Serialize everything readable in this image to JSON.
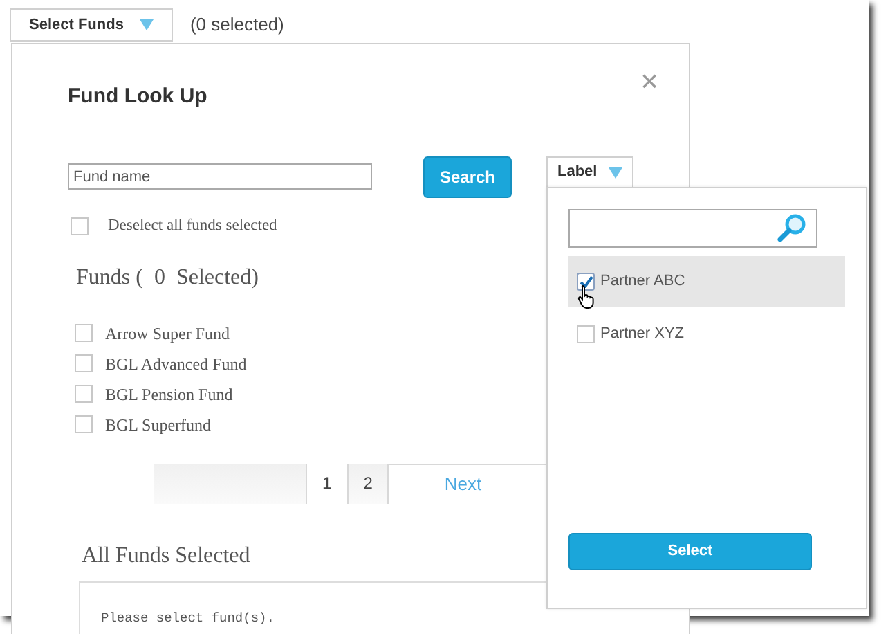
{
  "top_bar": {
    "button": "Select Funds",
    "count": "(0 selected)"
  },
  "dialog": {
    "title": "Fund Look Up",
    "close": "×",
    "search_field": {
      "placeholder": "Fund name"
    },
    "search_button": "Search",
    "label_button": "Label",
    "deselect": {
      "label": "Deselect all funds selected",
      "checked": false
    },
    "funds_heading": "Funds (  0  Selected)",
    "funds": [
      {
        "name": "Arrow Super Fund",
        "checked": false
      },
      {
        "name": "BGL Advanced Fund",
        "checked": false
      },
      {
        "name": "BGL Pension Fund",
        "checked": false
      },
      {
        "name": "BGL Superfund",
        "checked": false
      }
    ],
    "pages": [
      {
        "label": "1",
        "selected": true
      },
      {
        "label": "2",
        "selected": false
      }
    ],
    "next": "Next",
    "selected_heading": "All Funds Selected",
    "selected_message": "Please select fund(s)."
  },
  "label_dropdown": {
    "labels": [
      {
        "name": "Partner ABC",
        "checked": true,
        "hovered": true
      },
      {
        "name": "Partner XYZ",
        "checked": false,
        "hovered": false
      }
    ],
    "button": "Select"
  }
}
